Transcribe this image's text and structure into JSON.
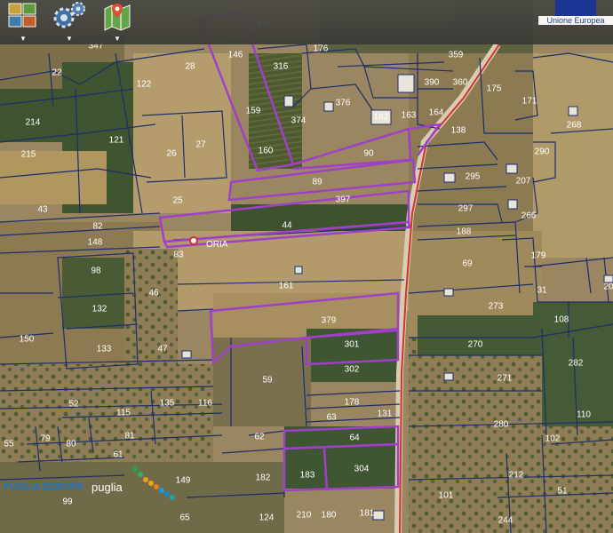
{
  "toolbar": {
    "buttons": [
      {
        "name": "layers-icon"
      },
      {
        "name": "gear-icon"
      },
      {
        "name": "map-icon"
      }
    ],
    "arrow": "▼",
    "eu_label": "Unione Europea",
    "eu_color": "#12309a"
  },
  "map": {
    "place_label": "ORIA",
    "parcels": [
      {
        "n": "347"
      },
      {
        "n": "337"
      },
      {
        "n": "176"
      },
      {
        "n": "359"
      },
      {
        "n": "22"
      },
      {
        "n": "28"
      },
      {
        "n": "146"
      },
      {
        "n": "316"
      },
      {
        "n": "390"
      },
      {
        "n": "360"
      },
      {
        "n": "175"
      },
      {
        "n": "122"
      },
      {
        "n": "376"
      },
      {
        "n": "171"
      },
      {
        "n": "214"
      },
      {
        "n": "159"
      },
      {
        "n": "374"
      },
      {
        "n": "162"
      },
      {
        "n": "163"
      },
      {
        "n": "164"
      },
      {
        "n": "268"
      },
      {
        "n": "121"
      },
      {
        "n": "138"
      },
      {
        "n": "26"
      },
      {
        "n": "27"
      },
      {
        "n": "160"
      },
      {
        "n": "90"
      },
      {
        "n": "215"
      },
      {
        "n": "290"
      },
      {
        "n": "89"
      },
      {
        "n": "295"
      },
      {
        "n": "207"
      },
      {
        "n": "25"
      },
      {
        "n": "397"
      },
      {
        "n": "43"
      },
      {
        "n": "297"
      },
      {
        "n": "266"
      },
      {
        "n": "82"
      },
      {
        "n": "44"
      },
      {
        "n": "188"
      },
      {
        "n": "148"
      },
      {
        "n": "83"
      },
      {
        "n": "179"
      },
      {
        "n": "69"
      },
      {
        "n": "98"
      },
      {
        "n": "46"
      },
      {
        "n": "161"
      },
      {
        "n": "31"
      },
      {
        "n": "20"
      },
      {
        "n": "132"
      },
      {
        "n": "273"
      },
      {
        "n": "379"
      },
      {
        "n": "108"
      },
      {
        "n": "150"
      },
      {
        "n": "133"
      },
      {
        "n": "47"
      },
      {
        "n": "301"
      },
      {
        "n": "270"
      },
      {
        "n": "282"
      },
      {
        "n": "302"
      },
      {
        "n": "59"
      },
      {
        "n": "271"
      },
      {
        "n": "52"
      },
      {
        "n": "135"
      },
      {
        "n": "116"
      },
      {
        "n": "178"
      },
      {
        "n": "115"
      },
      {
        "n": "63"
      },
      {
        "n": "131"
      },
      {
        "n": "110"
      },
      {
        "n": "280"
      },
      {
        "n": "81"
      },
      {
        "n": "62"
      },
      {
        "n": "64"
      },
      {
        "n": "55"
      },
      {
        "n": "79"
      },
      {
        "n": "80"
      },
      {
        "n": "102"
      },
      {
        "n": "61"
      },
      {
        "n": "149"
      },
      {
        "n": "182"
      },
      {
        "n": "183"
      },
      {
        "n": "304"
      },
      {
        "n": "212"
      },
      {
        "n": "101"
      },
      {
        "n": "51"
      },
      {
        "n": "99"
      },
      {
        "n": "65"
      },
      {
        "n": "124"
      },
      {
        "n": "210"
      },
      {
        "n": "180"
      },
      {
        "n": "181"
      },
      {
        "n": "244"
      }
    ]
  },
  "brand": {
    "puglia_europa": "PUGLIA EUROPA",
    "puglia": "puglia"
  }
}
